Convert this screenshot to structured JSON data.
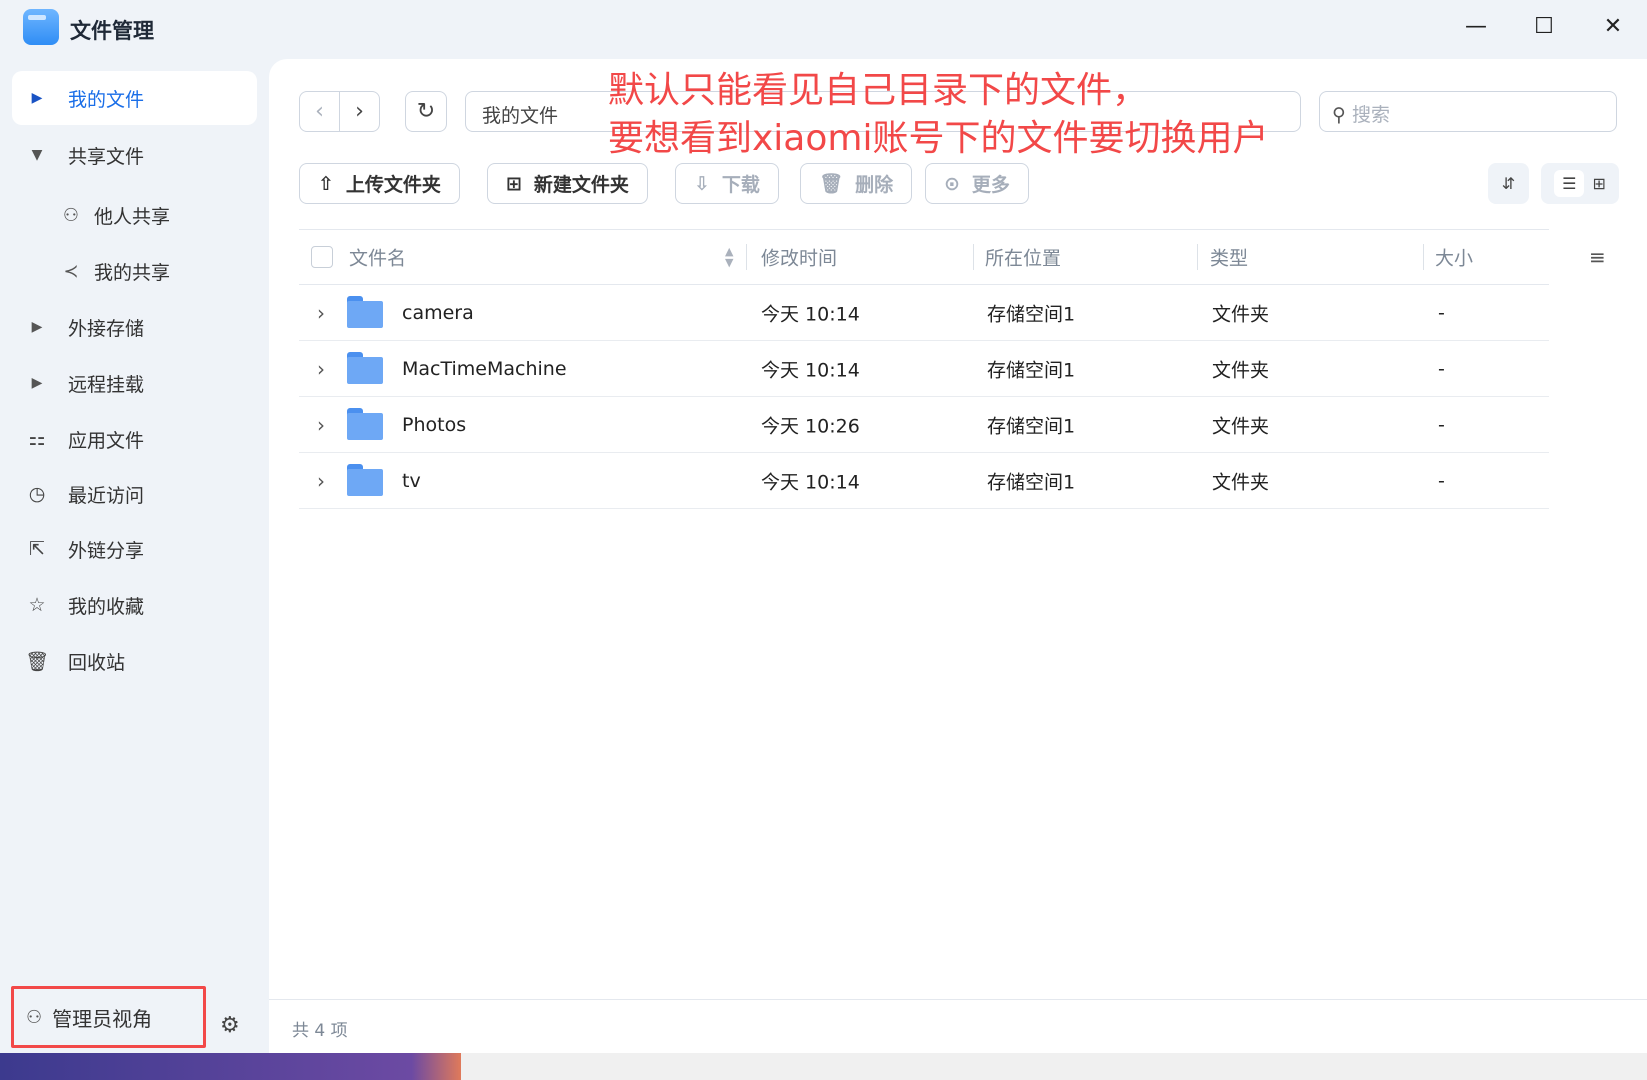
{
  "window": {
    "title": "文件管理",
    "minimize": "—",
    "maximize": "☐",
    "close": "✕"
  },
  "sidebar": {
    "items": [
      {
        "label": "我的文件",
        "icon": "caret-right-icon",
        "glyph": "▶"
      },
      {
        "label": "共享文件",
        "icon": "caret-down-icon",
        "glyph": "▼"
      },
      {
        "label": "他人共享",
        "icon": "users-icon",
        "glyph": "👥"
      },
      {
        "label": "我的共享",
        "icon": "share-icon",
        "glyph": "⋖"
      },
      {
        "label": "外接存储",
        "icon": "caret-right-icon",
        "glyph": "▶"
      },
      {
        "label": "远程挂载",
        "icon": "caret-right-icon",
        "glyph": "▶"
      },
      {
        "label": "应用文件",
        "icon": "apps-icon",
        "glyph": "⚏"
      },
      {
        "label": "最近访问",
        "icon": "clock-icon",
        "glyph": "◷"
      },
      {
        "label": "外链分享",
        "icon": "external-share-icon",
        "glyph": "⇱"
      },
      {
        "label": "我的收藏",
        "icon": "star-icon",
        "glyph": "☆"
      },
      {
        "label": "回收站",
        "icon": "trash-icon",
        "glyph": "🗑"
      }
    ],
    "admin_view": "管理员视角"
  },
  "toolbar": {
    "path": "我的文件",
    "search_placeholder": "搜索",
    "upload": "上传文件夹",
    "new_folder": "新建文件夹",
    "download": "下载",
    "delete": "删除",
    "more": "更多"
  },
  "annotation": {
    "line1": "默认只能看见自己目录下的文件，",
    "line2": "要想看到xiaomi账号下的文件要切换用户"
  },
  "table": {
    "headers": {
      "name": "文件名",
      "modified": "修改时间",
      "location": "所在位置",
      "type": "类型",
      "size": "大小"
    },
    "rows": [
      {
        "name": "camera",
        "modified": "今天 10:14",
        "location": "存储空间1",
        "type": "文件夹",
        "size": "-"
      },
      {
        "name": "MacTimeMachine",
        "modified": "今天 10:14",
        "location": "存储空间1",
        "type": "文件夹",
        "size": "-"
      },
      {
        "name": "Photos",
        "modified": "今天 10:26",
        "location": "存储空间1",
        "type": "文件夹",
        "size": "-"
      },
      {
        "name": "tv",
        "modified": "今天 10:14",
        "location": "存储空间1",
        "type": "文件夹",
        "size": "-"
      }
    ]
  },
  "footer": {
    "count": "共 4 项"
  }
}
